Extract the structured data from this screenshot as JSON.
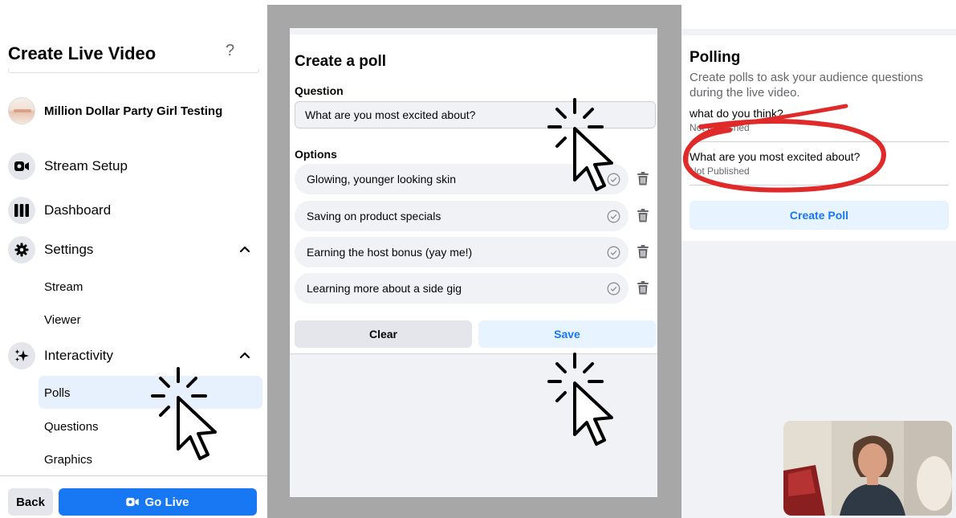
{
  "sidebar": {
    "title": "Create Live Video",
    "help": "?",
    "page_name": "Million Dollar Party Girl Testing",
    "nav": {
      "stream_setup": "Stream Setup",
      "dashboard": "Dashboard",
      "settings": "Settings",
      "interactivity": "Interactivity"
    },
    "settings_items": [
      "Stream",
      "Viewer"
    ],
    "interactivity_items": [
      "Polls",
      "Questions",
      "Graphics"
    ],
    "back_label": "Back",
    "go_live_label": "Go Live"
  },
  "poll_editor": {
    "title": "Create a poll",
    "question_label": "Question",
    "question_value": "What are you most excited about?",
    "options_label": "Options",
    "options": [
      "Glowing, younger looking skin",
      "Saving on product specials",
      "Earning the host bonus (yay me!)",
      "Learning more about a side gig"
    ],
    "clear_label": "Clear",
    "save_label": "Save"
  },
  "polling": {
    "title": "Polling",
    "description": "Create polls to ask your audience questions during the live video.",
    "polls": [
      {
        "question": "what do you think?",
        "status": "Not Published"
      },
      {
        "question": "What are you most excited about?",
        "status": "Not Published"
      }
    ],
    "create_label": "Create Poll"
  },
  "colors": {
    "primary": "#1877f2",
    "active_bg": "#e7f0fd",
    "annotation_red": "#e02a2a"
  }
}
